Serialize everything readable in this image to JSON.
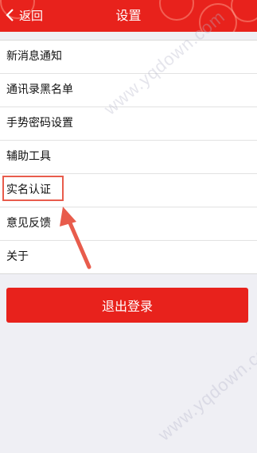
{
  "header": {
    "back_label": "返回",
    "title": "设置"
  },
  "menu": {
    "items": [
      {
        "label": "新消息通知"
      },
      {
        "label": "通讯录黑名单"
      },
      {
        "label": "手势密码设置"
      },
      {
        "label": "辅助工具"
      },
      {
        "label": "实名认证"
      },
      {
        "label": "意见反馈"
      },
      {
        "label": "关于"
      }
    ]
  },
  "logout_label": "退出登录",
  "watermarks": [
    "www.yqdown.com",
    "www.yqdown.com"
  ],
  "colors": {
    "brand_red": "#e8221c",
    "annotation": "#e85c4c"
  },
  "icons": {
    "back": "chevron-left-icon"
  }
}
